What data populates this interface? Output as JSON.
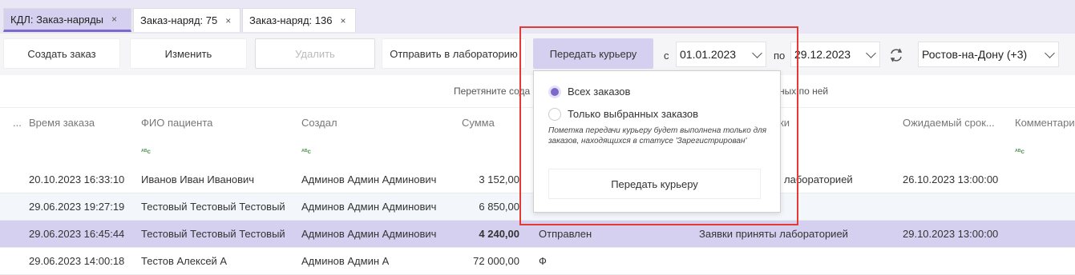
{
  "tabs": [
    {
      "label": "КДЛ: Заказ-наряды",
      "close": "×"
    },
    {
      "label": "Заказ-наряд: 75",
      "close": "×"
    },
    {
      "label": "Заказ-наряд: 136",
      "close": "×"
    }
  ],
  "toolbar": {
    "create": "Создать заказ",
    "edit": "Изменить",
    "delete": "Удалить",
    "send_lab": "Отправить в лабораторию",
    "courier": "Передать курьеру",
    "from_label": "с",
    "from_date": "01.01.2023",
    "to_label": "по",
    "to_date": "29.12.2023",
    "city": "Ростов-на-Дону (+3)"
  },
  "grid": {
    "drag_hint": "Перетяните сода",
    "drag_hint_end": "ных по ней",
    "columns": [
      "...",
      "Время заказа",
      "ФИО пациента",
      "Создал",
      "Сумма",
      "ки",
      "Ожидаемый срок...",
      "Комментарий"
    ],
    "filter_icon": "ᴬᴮc",
    "rows": [
      {
        "time": "20.10.2023 16:33:10",
        "patient": "Иванов Иван Иванович",
        "creator": "Админов Админ Админович",
        "sum": "3 152,00",
        "status": "",
        "applications": "лабораторией",
        "expected": "26.10.2023 13:00:00"
      },
      {
        "time": "29.06.2023 19:27:19",
        "patient": "Тестовый Тестовый Тестовый",
        "creator": "Админов Админ Админович",
        "sum": "6 850,00",
        "status": "",
        "applications": "",
        "expected": ""
      },
      {
        "time": "29.06.2023 16:45:44",
        "patient": "Тестовый Тестовый Тестовый",
        "creator": "Админов Админ Админович",
        "sum": "4 240,00",
        "status": "Отправлен",
        "applications": "Заявки приняты лабораторией",
        "expected": "29.10.2023 13:00:00"
      },
      {
        "time": "29.06.2023 14:00:18",
        "patient": "Тестов Алексей А",
        "creator": "Админов Админ А",
        "sum": "72 000,00",
        "status": "Ф",
        "applications": "",
        "expected": ""
      }
    ]
  },
  "popup": {
    "opt_all": "Всех заказов",
    "opt_selected": "Только выбранных заказов",
    "note": "Пометка передачи курьеру будет выполнена только для заказов, находящихся в статусе 'Зарегистрирован'",
    "button": "Передать курьеру"
  },
  "colors": {
    "accent": "#7b68c8",
    "selection": "#d6d0f0",
    "highlight": "#e53935"
  }
}
